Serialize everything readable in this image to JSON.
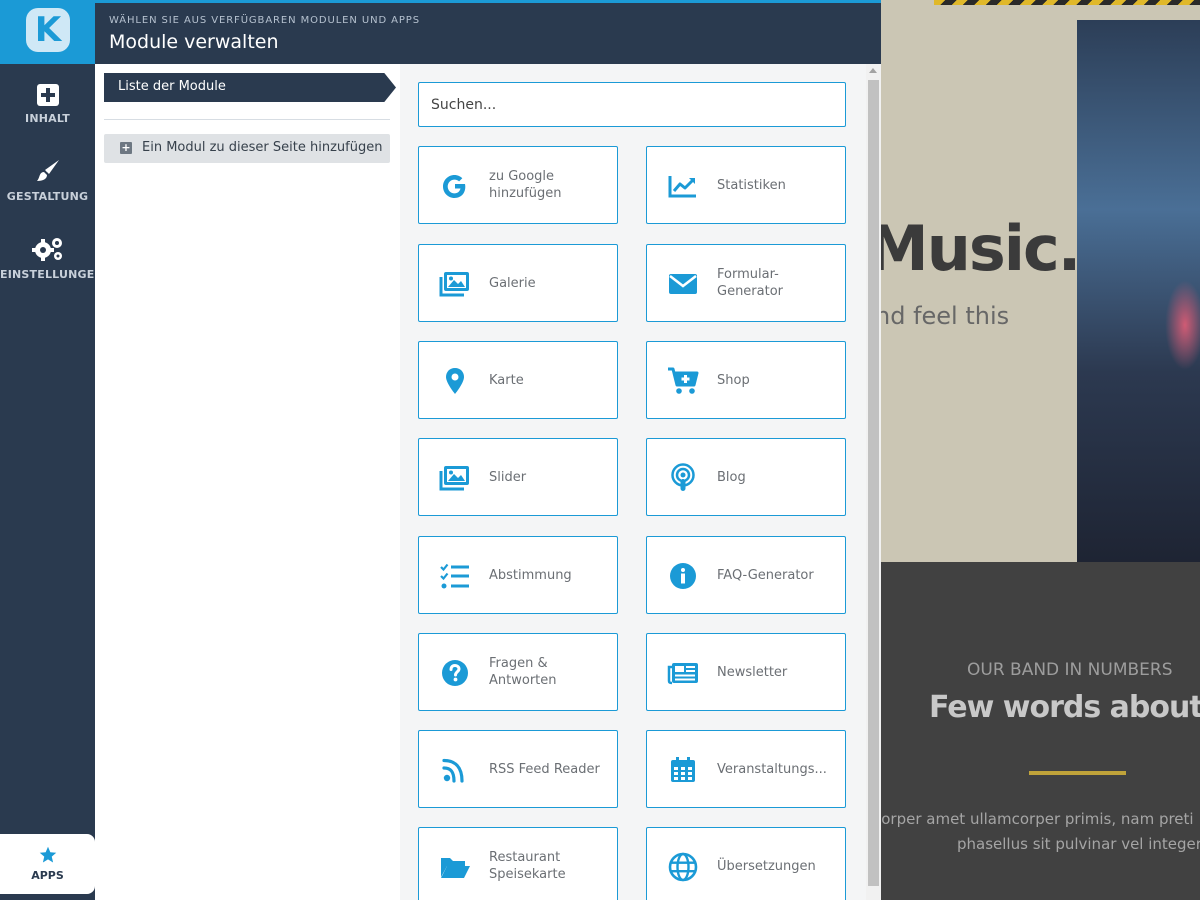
{
  "sidebar": {
    "logo_letter": "K",
    "items": [
      {
        "label": "INHALT",
        "icon": "plus-square-icon"
      },
      {
        "label": "GESTALTUNG",
        "icon": "brush-icon"
      },
      {
        "label": "EINSTELLUNGEN",
        "icon": "gears-icon"
      }
    ],
    "apps_label": "APPS",
    "apps_icon": "star-icon"
  },
  "header": {
    "subtitle": "WÄHLEN SIE AUS VERFÜGBAREN MODULEN UND APPS",
    "title": "Module verwalten",
    "collapse_icon": "chevron-left-icon"
  },
  "left_panel": {
    "tab_label": "Liste der Module",
    "add_module_label": "Ein Modul zu dieser Seite hinzufügen",
    "add_module_icon": "plus-square-icon"
  },
  "search": {
    "placeholder": "Suchen..."
  },
  "modules": [
    {
      "label": "zu Google hinzufügen",
      "icon": "google-icon"
    },
    {
      "label": "Statistiken",
      "icon": "chart-line-icon"
    },
    {
      "label": "Galerie",
      "icon": "images-icon"
    },
    {
      "label": "Formular-Generator",
      "icon": "envelope-icon"
    },
    {
      "label": "Karte",
      "icon": "map-marker-icon"
    },
    {
      "label": "Shop",
      "icon": "cart-plus-icon"
    },
    {
      "label": "Slider",
      "icon": "images-icon"
    },
    {
      "label": "Blog",
      "icon": "podcast-icon"
    },
    {
      "label": "Abstimmung",
      "icon": "tasks-icon"
    },
    {
      "label": "FAQ-Generator",
      "icon": "info-circle-icon"
    },
    {
      "label": "Fragen & Antworten",
      "icon": "question-circle-icon"
    },
    {
      "label": "Newsletter",
      "icon": "newspaper-icon"
    },
    {
      "label": "RSS Feed Reader",
      "icon": "rss-icon"
    },
    {
      "label": "Veranstaltungs...",
      "icon": "calendar-icon"
    },
    {
      "label": "Restaurant Speisekarte",
      "icon": "folder-open-icon"
    },
    {
      "label": "Übersetzungen",
      "icon": "globe-icon"
    }
  ],
  "preview": {
    "hero_title": "Music.",
    "hero_subtitle": "nd feel this",
    "band_kicker": "OUR BAND IN NUMBERS",
    "band_title": "Few words about u",
    "band_text_1": "corper amet ullamcorper primis, nam preti",
    "band_text_2": "phasellus sit pulvinar vel integer."
  },
  "colors": {
    "accent": "#1b9ad6",
    "sidebar": "#2a3a4f",
    "card_text": "#6b6f74"
  }
}
